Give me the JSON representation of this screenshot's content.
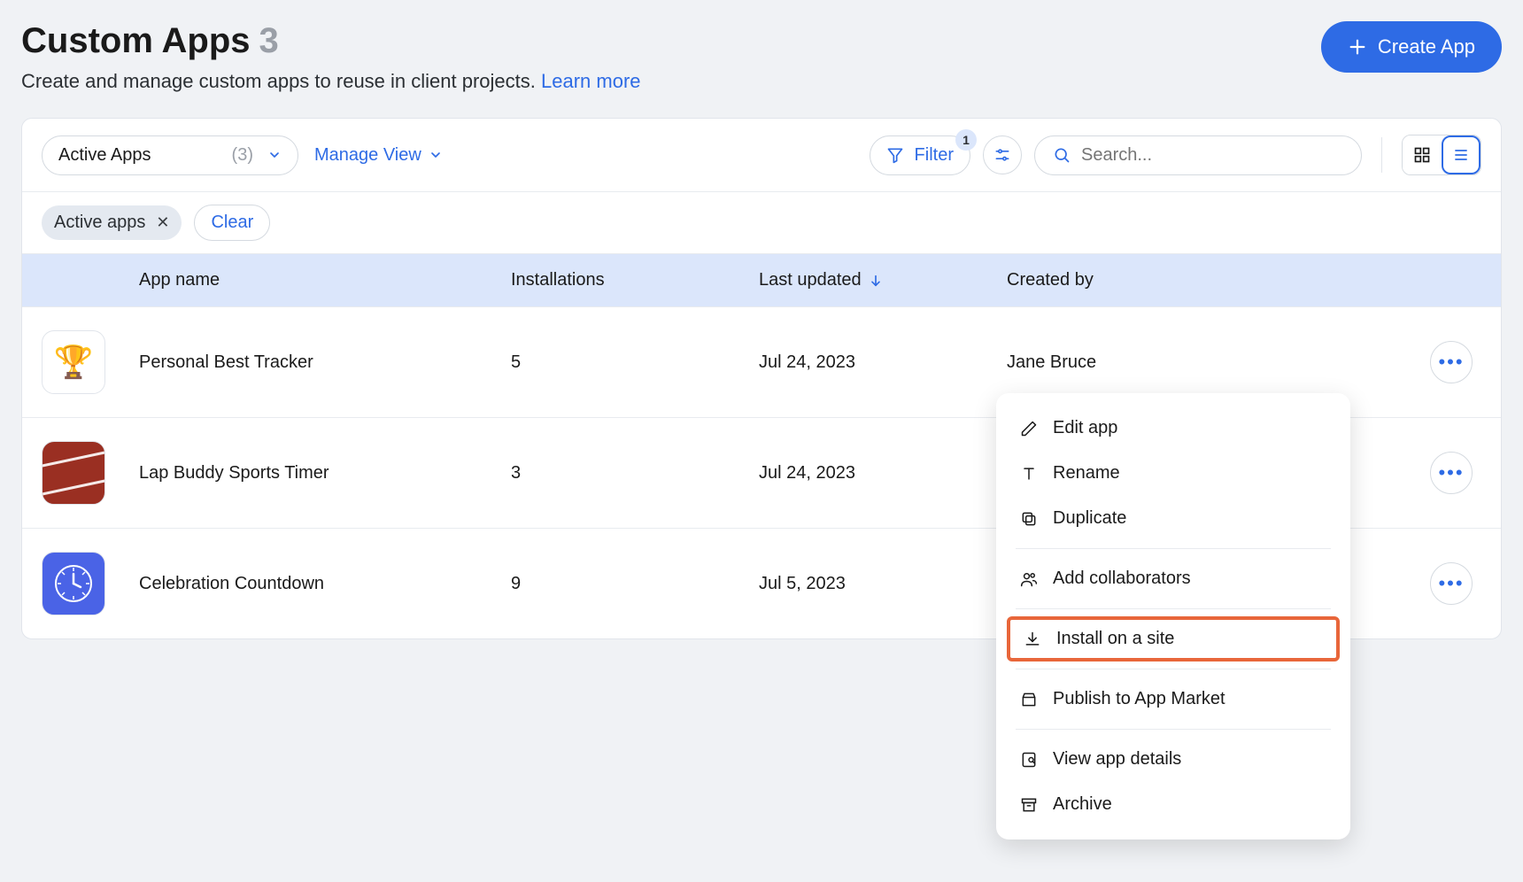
{
  "header": {
    "title": "Custom Apps",
    "count": "3",
    "subtitle": "Create and manage custom apps to reuse in client projects.",
    "learn_more": "Learn more",
    "create_label": "Create App"
  },
  "toolbar": {
    "view_select": {
      "label": "Active Apps",
      "count": "(3)"
    },
    "manage_view": "Manage View",
    "filter_label": "Filter",
    "filter_badge": "1",
    "search_placeholder": "Search..."
  },
  "chips": {
    "active": "Active apps",
    "clear": "Clear"
  },
  "columns": {
    "name": "App name",
    "installations": "Installations",
    "last_updated": "Last updated",
    "created_by": "Created by"
  },
  "rows": [
    {
      "name": "Personal Best Tracker",
      "installations": "5",
      "last_updated": "Jul 24, 2023",
      "created_by": "Jane Bruce",
      "icon": "trophy"
    },
    {
      "name": "Lap Buddy Sports Timer",
      "installations": "3",
      "last_updated": "Jul 24, 2023",
      "created_by": "",
      "icon": "track"
    },
    {
      "name": "Celebration Countdown",
      "installations": "9",
      "last_updated": "Jul 5, 2023",
      "created_by": "",
      "icon": "clock"
    }
  ],
  "menu": {
    "edit": "Edit app",
    "rename": "Rename",
    "duplicate": "Duplicate",
    "collab": "Add collaborators",
    "install": "Install on a site",
    "publish": "Publish to App Market",
    "details": "View app details",
    "archive": "Archive"
  }
}
